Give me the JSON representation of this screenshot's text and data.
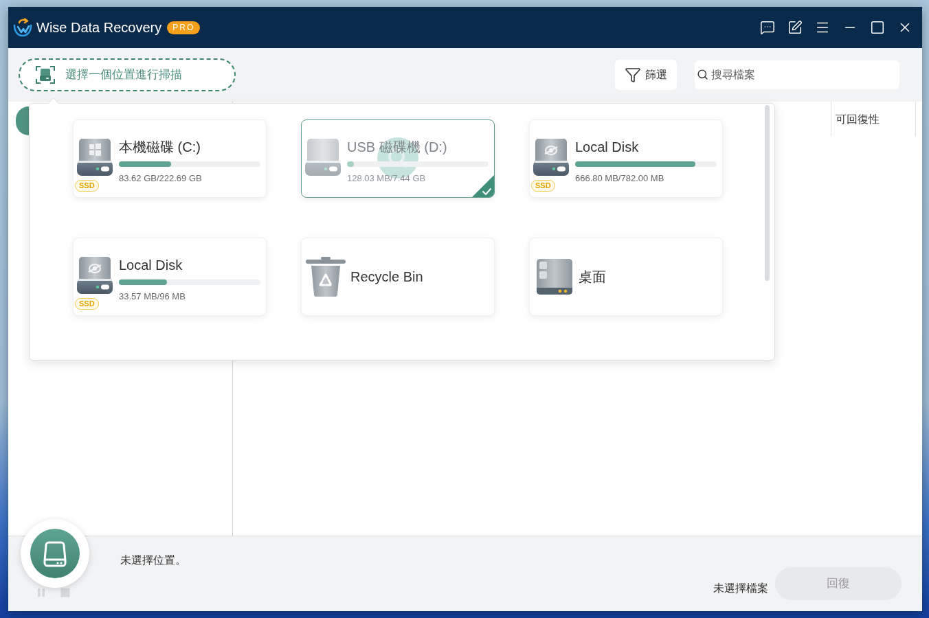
{
  "window": {
    "title": "Wise Data Recovery",
    "badge": "PRO"
  },
  "toolbar": {
    "scan_location": {
      "label": "選擇一個位置進行掃描"
    },
    "filter": {
      "label": "篩選"
    },
    "search": {
      "placeholder": "搜尋檔案"
    }
  },
  "table": {
    "columns": [
      {
        "label": "可回復性"
      }
    ]
  },
  "location_picker": {
    "locations": [
      {
        "kind": "system-drive",
        "name": "本機磁碟 (C:)",
        "size": "83.62 GB/222.69 GB",
        "level": 0.37,
        "badge": "SSD",
        "selected": false,
        "loading": false
      },
      {
        "kind": "usb-drive",
        "name": "USB 磁碟機 (D:)",
        "size": "128.03 MB/7.44 GB",
        "level": 0.05,
        "selected": true,
        "loading": true
      },
      {
        "kind": "local-drive",
        "name": "Local Disk",
        "size": "666.80 MB/782.00 MB",
        "level": 0.85,
        "badge": "SSD",
        "selected": false,
        "loading": false
      },
      {
        "kind": "local-drive",
        "name": "Local Disk",
        "size": "33.57 MB/96 MB",
        "level": 0.34,
        "badge": "SSD",
        "selected": false,
        "loading": false
      },
      {
        "kind": "recycle-bin",
        "name": "Recycle Bin",
        "selected": false,
        "loading": false
      },
      {
        "kind": "folder",
        "name": "桌面",
        "selected": false,
        "loading": false
      }
    ]
  },
  "scan_controls": {
    "disabled": true
  },
  "status_bar": {
    "location_status": "未選擇位置。",
    "file_status": "未選擇檔案",
    "recover_button": {
      "label": "回復",
      "disabled": true
    }
  }
}
